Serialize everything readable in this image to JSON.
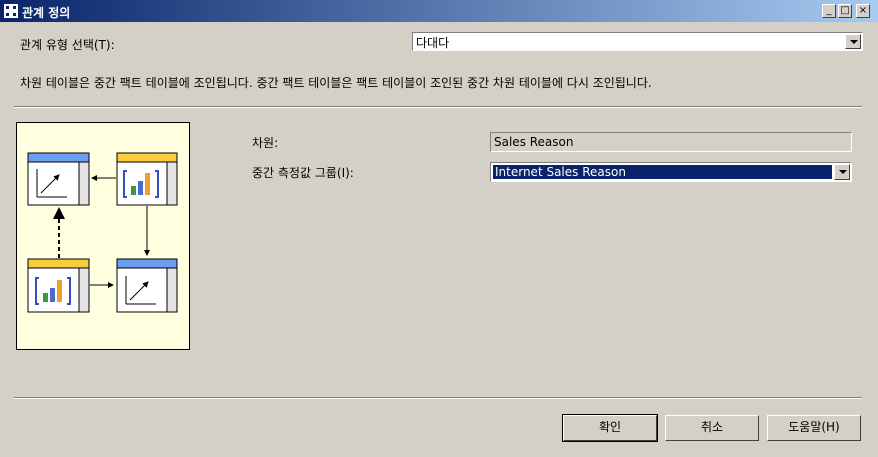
{
  "window": {
    "title": "관계 정의",
    "minimize": "_",
    "maximize": "□",
    "close": "×"
  },
  "relationship_type": {
    "label": "관계 유형 선택(T):",
    "value": "다대다"
  },
  "description": "차원 테이블은 중간 팩트 테이블에 조인됩니다. 중간 팩트 테이블은 팩트 테이블이 조인된 중간 차원 테이블에 다시 조인됩니다.",
  "form": {
    "dimension_label": "차원:",
    "dimension_value": "Sales Reason",
    "measure_group_label": "중간 측정값 그룹(I):",
    "measure_group_value": "Internet Sales Reason"
  },
  "buttons": {
    "ok": "확인",
    "cancel": "취소",
    "help": "도움말(H)"
  },
  "diagram": {
    "icons": [
      "dimension-table-icon",
      "fact-table-icon"
    ]
  }
}
